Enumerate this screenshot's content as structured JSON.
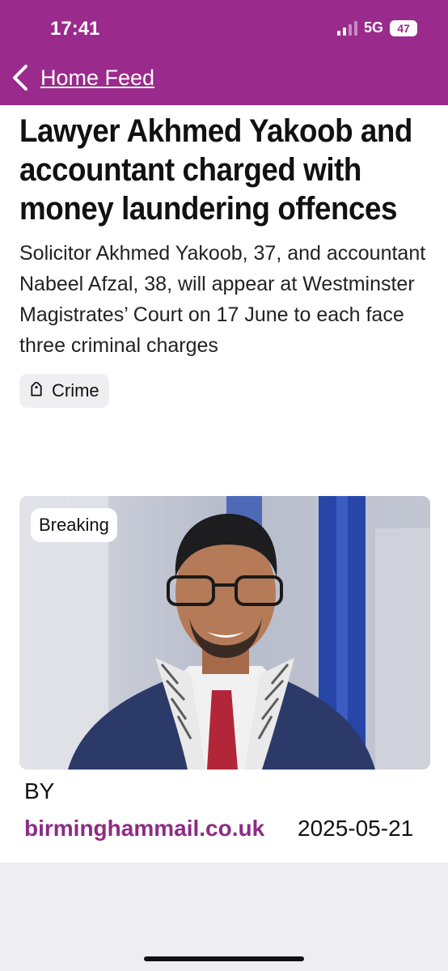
{
  "status_bar": {
    "time": "17:41",
    "network": "5G",
    "battery": "47"
  },
  "nav": {
    "back_label": "Home Feed"
  },
  "article": {
    "headline": "Lawyer Akhmed Yakoob and accountant charged with money laundering offences",
    "summary": "Solicitor Akhmed Yakoob, 37, and accountant Nabeel Afzal, 38, will appear at Westminster Magistrates’ Court on 17 June to each face three criminal charges",
    "tag": "Crime",
    "badge": "Breaking",
    "by_label": "BY",
    "source": "birminghammail.co.uk",
    "date": "2025-05-21"
  },
  "colors": {
    "brand": "#9a2a8c",
    "source_link": "#8e2b84",
    "tag_bg": "#efeff2"
  },
  "icons": {
    "back": "chevron-left-icon",
    "tag": "tag-icon",
    "signal": "signal-bars-icon",
    "battery": "battery-icon"
  }
}
